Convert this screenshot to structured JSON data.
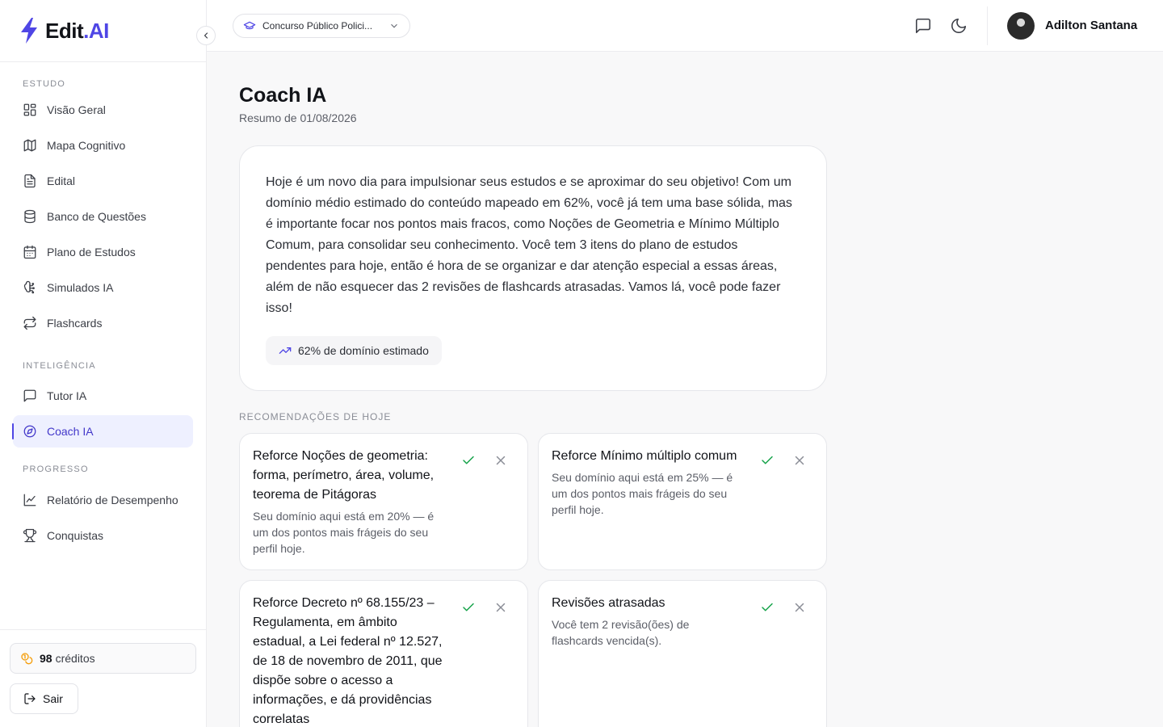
{
  "brand": {
    "name": "Edit",
    "suffix": ".AI"
  },
  "sidebar": {
    "sections": [
      {
        "label": "ESTUDO",
        "items": [
          "Visão Geral",
          "Mapa Cognitivo",
          "Edital",
          "Banco de Questões",
          "Plano de Estudos",
          "Simulados IA",
          "Flashcards"
        ]
      },
      {
        "label": "INTELIGÊNCIA",
        "items": [
          "Tutor IA",
          "Coach IA"
        ]
      },
      {
        "label": "PROGRESSO",
        "items": [
          "Relatório de Desempenho",
          "Conquistas"
        ]
      }
    ],
    "labels": {
      "estudo": "ESTUDO",
      "inteligencia": "INTELIGÊNCIA",
      "progresso": "PROGRESSO"
    },
    "items": {
      "visao_geral": "Visão Geral",
      "mapa_cognitivo": "Mapa Cognitivo",
      "edital": "Edital",
      "banco_questoes": "Banco de Questões",
      "plano_estudos": "Plano de Estudos",
      "simulados": "Simulados IA",
      "flashcards": "Flashcards",
      "tutor": "Tutor IA",
      "coach": "Coach IA",
      "relatorio": "Relatório de Desempenho",
      "conquistas": "Conquistas"
    },
    "active_item": "Coach IA",
    "credits": {
      "amount": "98",
      "label": "créditos"
    },
    "logout_label": "Sair"
  },
  "header": {
    "course": "Concurso Público Polici...",
    "user_name": "Adilton Santana"
  },
  "main": {
    "title": "Coach IA",
    "subtitle": "Resumo de 01/08/2026",
    "summary": "Hoje é um novo dia para impulsionar seus estudos e se aproximar do seu objetivo! Com um domínio médio estimado do conteúdo mapeado em 62%, você já tem uma base sólida, mas é importante focar nos pontos mais fracos, como Noções de Geometria e Mínimo Múltiplo Comum, para consolidar seu conhecimento. Você tem 3 itens do plano de estudos pendentes para hoje, então é hora de se organizar e dar atenção especial a essas áreas, além de não esquecer das 2 revisões de flashcards atrasadas. Vamos lá, você pode fazer isso!",
    "mastery_pill": "62% de domínio estimado",
    "mastery_percent": 62,
    "recommendations_label": "RECOMENDAÇÕES DE HOJE",
    "recommendations": [
      {
        "title": "Reforce Noções de geometria: forma, perímetro, área, volume, teorema de Pitágoras",
        "desc": "Seu domínio aqui está em 20% — é um dos pontos mais frágeis do seu perfil hoje."
      },
      {
        "title": "Reforce Mínimo múltiplo comum",
        "desc": "Seu domínio aqui está em 25% — é um dos pontos mais frágeis do seu perfil hoje."
      },
      {
        "title": "Reforce Decreto nº 68.155/23 – Regulamenta, em âmbito estadual, a Lei federal nº 12.527, de 18 de novembro de 2011, que dispõe sobre o acesso a informações, e dá providências correlatas",
        "desc": ""
      },
      {
        "title": "Revisões atrasadas",
        "desc": "Você tem 2 revisão(ões) de flashcards vencida(s)."
      }
    ]
  },
  "colors": {
    "accent": "#4f46e5",
    "success": "#16a34a",
    "credits": "#f59e0b"
  }
}
